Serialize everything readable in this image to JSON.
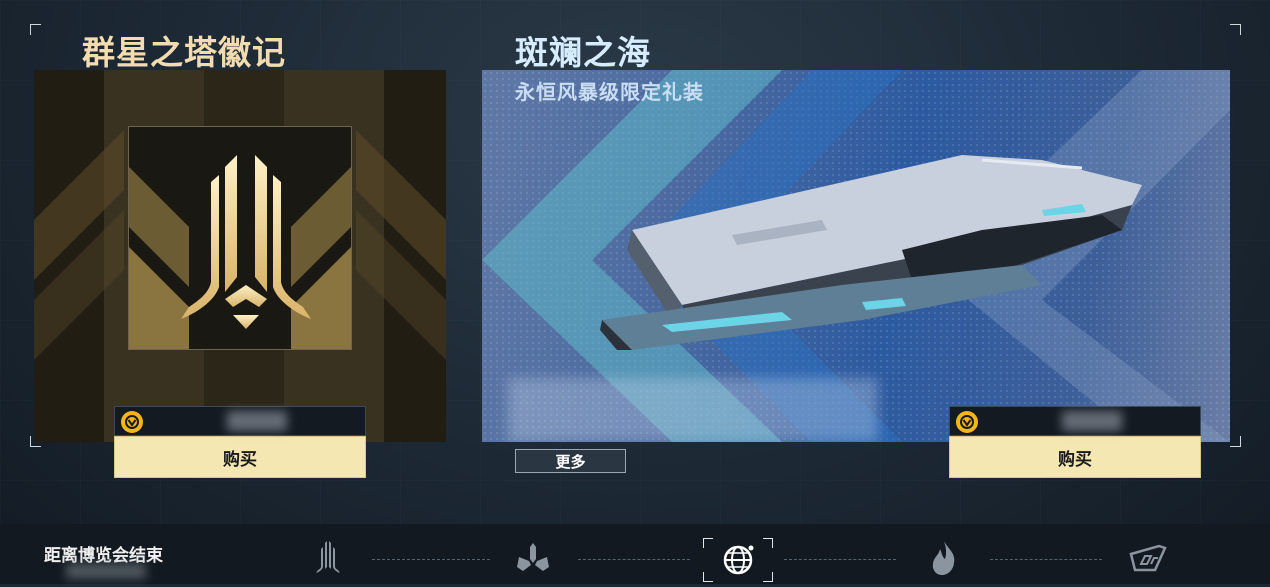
{
  "left_card": {
    "title": "群星之塔徽记",
    "buy_label": "购买",
    "icon": "tower-emblem-icon"
  },
  "right_card": {
    "title": "斑斓之海",
    "subtitle": "永恒风暴级限定礼装",
    "more_label": "更多",
    "buy_label": "购买"
  },
  "bottom_bar": {
    "end_label": "距离博览会结束",
    "nav": [
      "tower-icon",
      "tri-blade-icon",
      "globe-icon",
      "flame-icon",
      "ship-badge-icon"
    ]
  },
  "colors": {
    "gold": "#f3ddb0",
    "button": "#f4e7b1",
    "coin": "#f3b51c",
    "panel_blue": "#2c5aa0"
  }
}
